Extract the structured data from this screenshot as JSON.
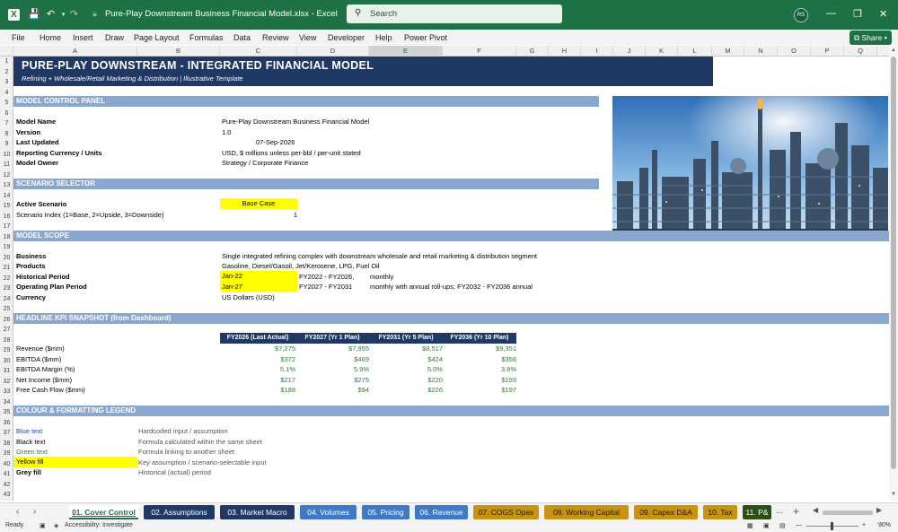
{
  "app": {
    "title": "Pure-Play Downstream Business Financial Model.xlsx  -  Excel",
    "search_placeholder": "Search",
    "user_initials": "RS",
    "share_label": "Share"
  },
  "menu": [
    "File",
    "Home",
    "Insert",
    "Draw",
    "Page Layout",
    "Formulas",
    "Data",
    "Review",
    "View",
    "Developer",
    "Help",
    "Power Pivot"
  ],
  "columns": [
    "A",
    "B",
    "C",
    "D",
    "E",
    "F",
    "G",
    "H",
    "I",
    "J",
    "K",
    "L",
    "M",
    "N",
    "O",
    "P",
    "Q"
  ],
  "rows": [
    "1",
    "2",
    "3",
    "4",
    "5",
    "6",
    "7",
    "8",
    "9",
    "10",
    "11",
    "12",
    "13",
    "14",
    "15",
    "16",
    "17",
    "18",
    "19",
    "20",
    "21",
    "22",
    "23",
    "24",
    "25",
    "26",
    "27",
    "28",
    "29",
    "30",
    "31",
    "32",
    "33",
    "34",
    "35",
    "36",
    "37",
    "38",
    "39",
    "40",
    "41",
    "42",
    "43"
  ],
  "sheet": {
    "title": "PURE-PLAY DOWNSTREAM - INTEGRATED FINANCIAL MODEL",
    "subtitle": "Refining + Wholesale/Retail Marketing & Distribution  |  Illustrative Template",
    "control_panel": {
      "header": "MODEL CONTROL PANEL",
      "items": [
        {
          "label": "Model Name",
          "value": "Pure-Play Downstream Business Financial Model"
        },
        {
          "label": "Version",
          "value": "1.0"
        },
        {
          "label": "Last Updated",
          "value": "07-Sep-2026"
        },
        {
          "label": "Reporting Currency / Units",
          "value": "USD, $ millions unless per-bbl / per-unit stated"
        },
        {
          "label": "Model Owner",
          "value": "Strategy / Corporate Finance"
        }
      ]
    },
    "scenario": {
      "header": "SCENARIO SELECTOR",
      "active_label": "Active Scenario",
      "active_value": "Base Case",
      "index_label": "Scenario Index (1=Base, 2=Upside, 3=Downside)",
      "index_value": "1"
    },
    "scope": {
      "header": "MODEL SCOPE",
      "business_label": "Business",
      "business_value": "Single integrated refining complex with downstream wholesale and retail marketing & distribution segment",
      "products_label": "Products",
      "products_value": "Gasoline, Diesel/Gasoil, Jet/Kerosene, LPG, Fuel Oil",
      "historical_label": "Historical Period",
      "historical_start": "Jan-22",
      "historical_range": "FY2022 - FY2026,",
      "historical_freq": "monthly",
      "operating_label": "Operating Plan Period",
      "operating_start": "Jan-27",
      "operating_range": "FY2027 - FY2031",
      "operating_freq": "monthly with annual roll-ups; FY2032 - FY2036 annual",
      "currency_label": "Currency",
      "currency_value": "US Dollars (USD)"
    },
    "kpi": {
      "header": "HEADLINE KPI SNAPSHOT (from Dashboard)",
      "columns": [
        "FY2026 (Last Actual)",
        "FY2027 (Yr 1 Plan)",
        "FY2031 (Yr 5 Plan)",
        "FY2036 (Yr 10 Plan)"
      ],
      "rows": [
        {
          "label": "Revenue ($mm)",
          "values": [
            "$7,275",
            "$7,955",
            "$8,517",
            "$9,351"
          ]
        },
        {
          "label": "EBITDA ($mm)",
          "values": [
            "$372",
            "$469",
            "$424",
            "$356"
          ]
        },
        {
          "label": "EBITDA Margin (%)",
          "values": [
            "5.1%",
            "5.9%",
            "5.0%",
            "3.8%"
          ]
        },
        {
          "label": "Net Income ($mm)",
          "values": [
            "$217",
            "$275",
            "$220",
            "$159"
          ]
        },
        {
          "label": "Free Cash Flow ($mm)",
          "values": [
            "$188",
            "$94",
            "$226",
            "$197"
          ]
        }
      ]
    },
    "legend": {
      "header": "COLOUR & FORMATTING LEGEND",
      "items": [
        {
          "label": "Blue text",
          "desc": "Hardcoded input / assumption"
        },
        {
          "label": "Black text",
          "desc": "Formula calculated within the same sheet"
        },
        {
          "label": "Green text",
          "desc": "Formula linking to another sheet"
        },
        {
          "label": "Yellow fill",
          "desc": "Key assumption / scenario-selectable input"
        },
        {
          "label": "Grey fill",
          "desc": "Historical (actual) period"
        }
      ]
    }
  },
  "tabs": [
    "01. Cover Control",
    "02. Assumptions",
    "03. Market Macro",
    "04. Volumes",
    "05. Pricing",
    "06. Revenue",
    "07. COGS Opex",
    "08. Working Capital",
    "09. Capex D&A",
    "10. Tax",
    "11. P&"
  ],
  "tab_more": "...",
  "tab_add": "+",
  "status": {
    "ready": "Ready",
    "accessibility": "Accessibility: Investigate",
    "zoom": "90%"
  },
  "colors": {
    "excel_green": "#1e7145",
    "title_navy": "#1f3864",
    "band_blue": "#8aa7cf",
    "input_yellow": "#ffff00",
    "link_green": "#2e7d32",
    "input_blue": "#1f3fbf"
  },
  "icons": [
    "excel-logo-icon",
    "autosave-icon",
    "undo-icon",
    "redo-icon",
    "search-icon",
    "minimize-icon",
    "maximize-icon",
    "close-icon"
  ]
}
